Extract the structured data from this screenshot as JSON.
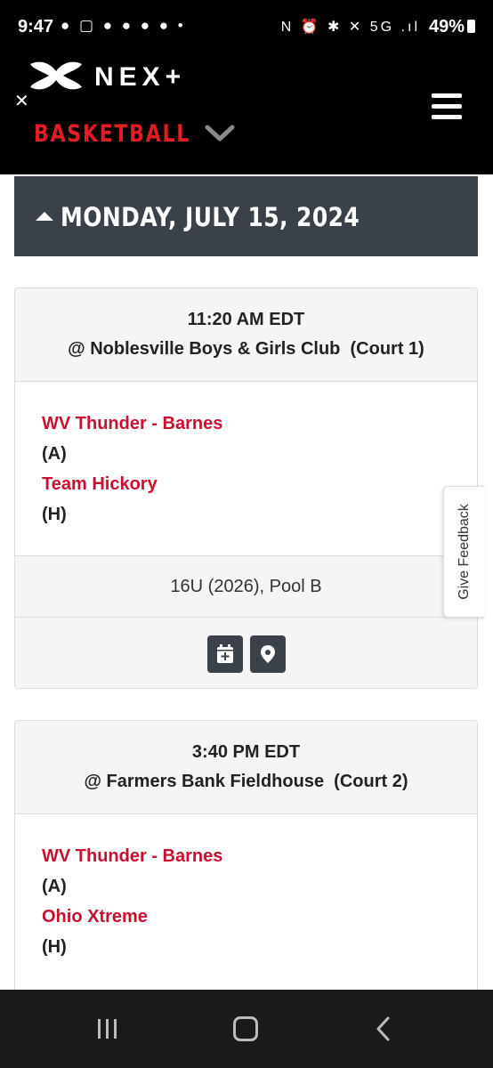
{
  "status_bar": {
    "time": "9:47",
    "left_icons": "● ▢ ● ● ● ● •",
    "right_icons": "N ⏰ ✱ ✕ 5G .ıl",
    "battery": "49%"
  },
  "header": {
    "brand": "NEX+",
    "sport": "BASKETBALL",
    "close_symbol": "✕"
  },
  "schedule": {
    "date": "MONDAY, JULY 15, 2024",
    "games": [
      {
        "time": "11:20 AM EDT",
        "venue": "@ Noblesville Boys & Girls Club  (Court 1)",
        "team1": "WV Thunder - Barnes",
        "team1_side": "(A)",
        "team2": "Team Hickory",
        "team2_side": "(H)",
        "division": "16U (2026), Pool B"
      },
      {
        "time": "3:40 PM EDT",
        "venue": "@ Farmers Bank Fieldhouse  (Court 2)",
        "team1": "WV Thunder - Barnes",
        "team1_side": "(A)",
        "team2": "Ohio Xtreme",
        "team2_side": "(H)"
      }
    ]
  },
  "feedback": {
    "label": "Give Feedback"
  },
  "colors": {
    "brand_red": "#e31b23",
    "team_red": "#c8102e",
    "header_bg": "#000000",
    "date_bar_bg": "#3b4148"
  }
}
